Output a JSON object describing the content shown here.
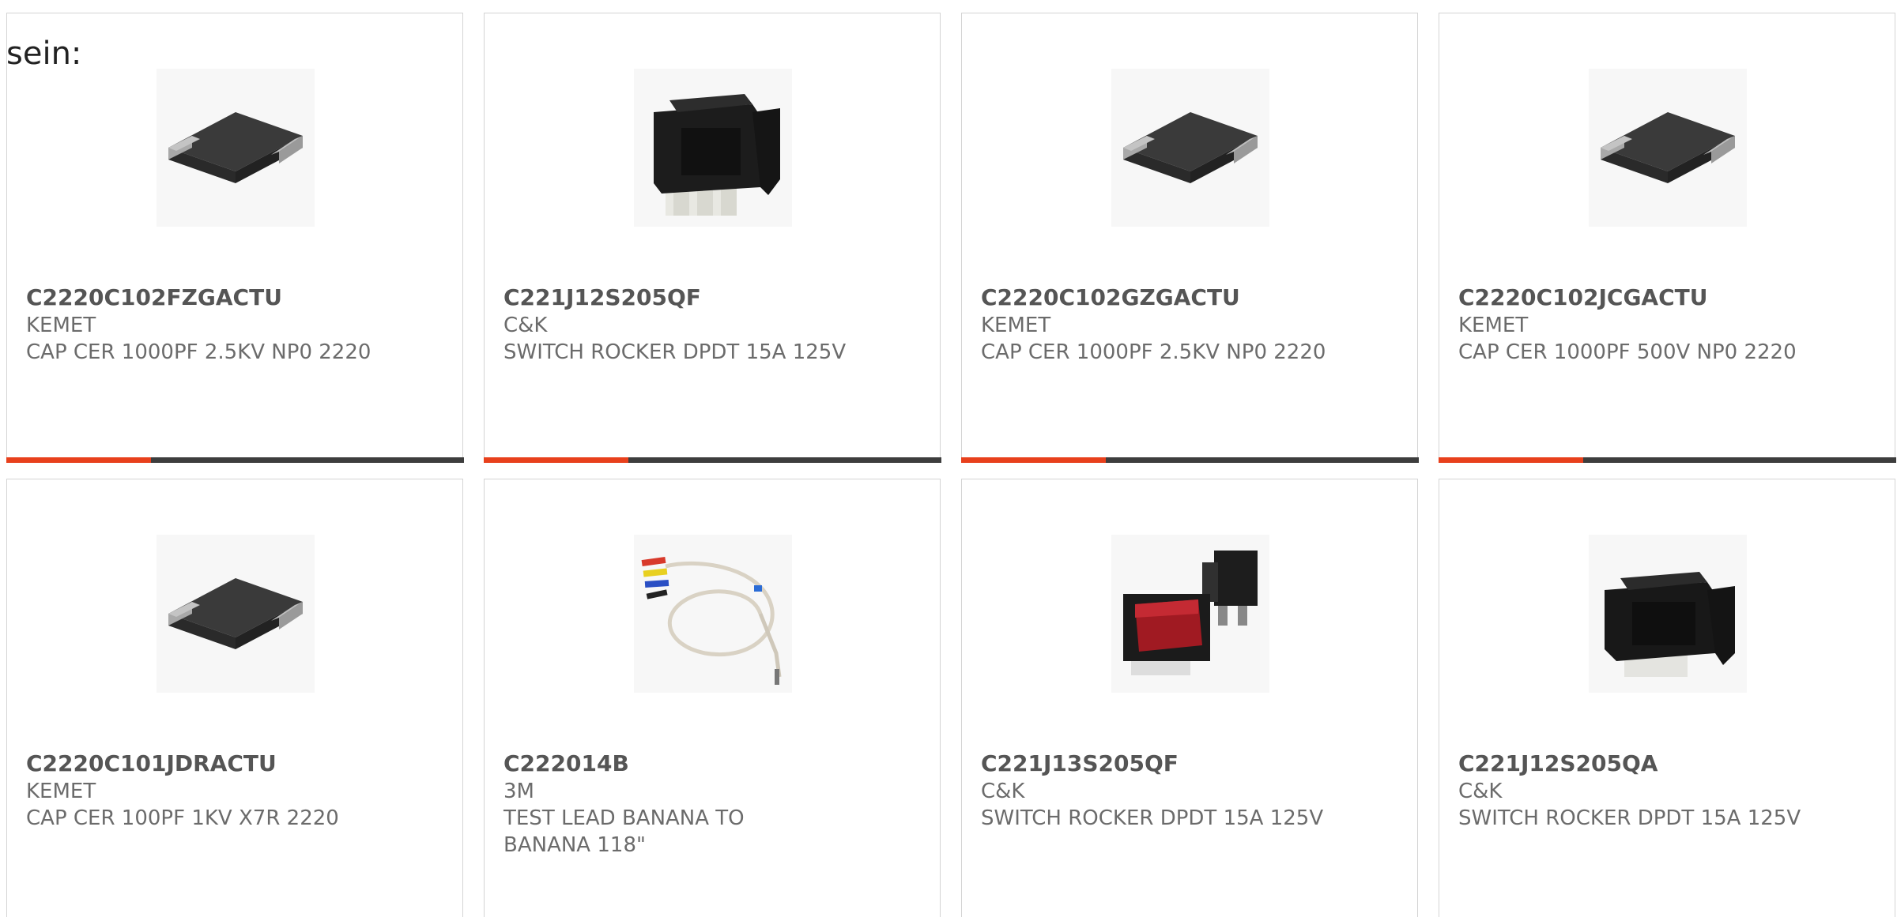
{
  "prefix_text": "sein:",
  "products": [
    {
      "part": "C2220C102FZGACTU",
      "brand": "KEMET",
      "desc": "CAP CER 1000PF 2.5KV NP0 2220",
      "image_icon": "ceramic-capacitor-icon"
    },
    {
      "part": "C221J12S205QF",
      "brand": "C&K",
      "desc": "SWITCH ROCKER DPDT 15A 125V",
      "image_icon": "rocker-switch-icon"
    },
    {
      "part": "C2220C102GZGACTU",
      "brand": "KEMET",
      "desc": "CAP CER 1000PF 2.5KV NP0 2220",
      "image_icon": "ceramic-capacitor-icon"
    },
    {
      "part": "C2220C102JCGACTU",
      "brand": "KEMET",
      "desc": "CAP CER 1000PF 500V NP0 2220",
      "image_icon": "ceramic-capacitor-icon"
    },
    {
      "part": "C2220C101JDRACTU",
      "brand": "KEMET",
      "desc": "CAP CER 100PF 1KV X7R 2220",
      "image_icon": "ceramic-capacitor-icon"
    },
    {
      "part": "C222014B",
      "brand": "3M",
      "desc": "TEST LEAD BANANA TO BANANA 118\"",
      "image_icon": "test-lead-icon"
    },
    {
      "part": "C221J13S205QF",
      "brand": "C&K",
      "desc": "SWITCH ROCKER DPDT 15A 125V",
      "image_icon": "red-rocker-switch-icon"
    },
    {
      "part": "C221J12S205QA",
      "brand": "C&K",
      "desc": "SWITCH ROCKER DPDT 15A 125V",
      "image_icon": "rocker-switch-icon"
    }
  ],
  "colors": {
    "accent": "#e8401c",
    "bar": "#3d3d3d",
    "border": "#d4d4d4",
    "text": "#6b6b6b"
  }
}
